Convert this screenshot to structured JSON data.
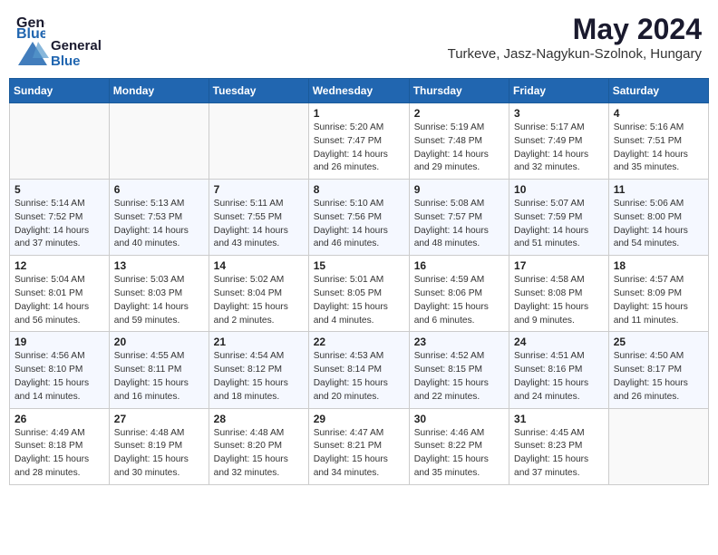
{
  "logo": {
    "general": "General",
    "blue": "Blue"
  },
  "title": {
    "month_year": "May 2024",
    "location": "Turkeve, Jasz-Nagykun-Szolnok, Hungary"
  },
  "days_of_week": [
    "Sunday",
    "Monday",
    "Tuesday",
    "Wednesday",
    "Thursday",
    "Friday",
    "Saturday"
  ],
  "weeks": [
    [
      {
        "day": "",
        "info": ""
      },
      {
        "day": "",
        "info": ""
      },
      {
        "day": "",
        "info": ""
      },
      {
        "day": "1",
        "info": "Sunrise: 5:20 AM\nSunset: 7:47 PM\nDaylight: 14 hours\nand 26 minutes."
      },
      {
        "day": "2",
        "info": "Sunrise: 5:19 AM\nSunset: 7:48 PM\nDaylight: 14 hours\nand 29 minutes."
      },
      {
        "day": "3",
        "info": "Sunrise: 5:17 AM\nSunset: 7:49 PM\nDaylight: 14 hours\nand 32 minutes."
      },
      {
        "day": "4",
        "info": "Sunrise: 5:16 AM\nSunset: 7:51 PM\nDaylight: 14 hours\nand 35 minutes."
      }
    ],
    [
      {
        "day": "5",
        "info": "Sunrise: 5:14 AM\nSunset: 7:52 PM\nDaylight: 14 hours\nand 37 minutes."
      },
      {
        "day": "6",
        "info": "Sunrise: 5:13 AM\nSunset: 7:53 PM\nDaylight: 14 hours\nand 40 minutes."
      },
      {
        "day": "7",
        "info": "Sunrise: 5:11 AM\nSunset: 7:55 PM\nDaylight: 14 hours\nand 43 minutes."
      },
      {
        "day": "8",
        "info": "Sunrise: 5:10 AM\nSunset: 7:56 PM\nDaylight: 14 hours\nand 46 minutes."
      },
      {
        "day": "9",
        "info": "Sunrise: 5:08 AM\nSunset: 7:57 PM\nDaylight: 14 hours\nand 48 minutes."
      },
      {
        "day": "10",
        "info": "Sunrise: 5:07 AM\nSunset: 7:59 PM\nDaylight: 14 hours\nand 51 minutes."
      },
      {
        "day": "11",
        "info": "Sunrise: 5:06 AM\nSunset: 8:00 PM\nDaylight: 14 hours\nand 54 minutes."
      }
    ],
    [
      {
        "day": "12",
        "info": "Sunrise: 5:04 AM\nSunset: 8:01 PM\nDaylight: 14 hours\nand 56 minutes."
      },
      {
        "day": "13",
        "info": "Sunrise: 5:03 AM\nSunset: 8:03 PM\nDaylight: 14 hours\nand 59 minutes."
      },
      {
        "day": "14",
        "info": "Sunrise: 5:02 AM\nSunset: 8:04 PM\nDaylight: 15 hours\nand 2 minutes."
      },
      {
        "day": "15",
        "info": "Sunrise: 5:01 AM\nSunset: 8:05 PM\nDaylight: 15 hours\nand 4 minutes."
      },
      {
        "day": "16",
        "info": "Sunrise: 4:59 AM\nSunset: 8:06 PM\nDaylight: 15 hours\nand 6 minutes."
      },
      {
        "day": "17",
        "info": "Sunrise: 4:58 AM\nSunset: 8:08 PM\nDaylight: 15 hours\nand 9 minutes."
      },
      {
        "day": "18",
        "info": "Sunrise: 4:57 AM\nSunset: 8:09 PM\nDaylight: 15 hours\nand 11 minutes."
      }
    ],
    [
      {
        "day": "19",
        "info": "Sunrise: 4:56 AM\nSunset: 8:10 PM\nDaylight: 15 hours\nand 14 minutes."
      },
      {
        "day": "20",
        "info": "Sunrise: 4:55 AM\nSunset: 8:11 PM\nDaylight: 15 hours\nand 16 minutes."
      },
      {
        "day": "21",
        "info": "Sunrise: 4:54 AM\nSunset: 8:12 PM\nDaylight: 15 hours\nand 18 minutes."
      },
      {
        "day": "22",
        "info": "Sunrise: 4:53 AM\nSunset: 8:14 PM\nDaylight: 15 hours\nand 20 minutes."
      },
      {
        "day": "23",
        "info": "Sunrise: 4:52 AM\nSunset: 8:15 PM\nDaylight: 15 hours\nand 22 minutes."
      },
      {
        "day": "24",
        "info": "Sunrise: 4:51 AM\nSunset: 8:16 PM\nDaylight: 15 hours\nand 24 minutes."
      },
      {
        "day": "25",
        "info": "Sunrise: 4:50 AM\nSunset: 8:17 PM\nDaylight: 15 hours\nand 26 minutes."
      }
    ],
    [
      {
        "day": "26",
        "info": "Sunrise: 4:49 AM\nSunset: 8:18 PM\nDaylight: 15 hours\nand 28 minutes."
      },
      {
        "day": "27",
        "info": "Sunrise: 4:48 AM\nSunset: 8:19 PM\nDaylight: 15 hours\nand 30 minutes."
      },
      {
        "day": "28",
        "info": "Sunrise: 4:48 AM\nSunset: 8:20 PM\nDaylight: 15 hours\nand 32 minutes."
      },
      {
        "day": "29",
        "info": "Sunrise: 4:47 AM\nSunset: 8:21 PM\nDaylight: 15 hours\nand 34 minutes."
      },
      {
        "day": "30",
        "info": "Sunrise: 4:46 AM\nSunset: 8:22 PM\nDaylight: 15 hours\nand 35 minutes."
      },
      {
        "day": "31",
        "info": "Sunrise: 4:45 AM\nSunset: 8:23 PM\nDaylight: 15 hours\nand 37 minutes."
      },
      {
        "day": "",
        "info": ""
      }
    ]
  ]
}
